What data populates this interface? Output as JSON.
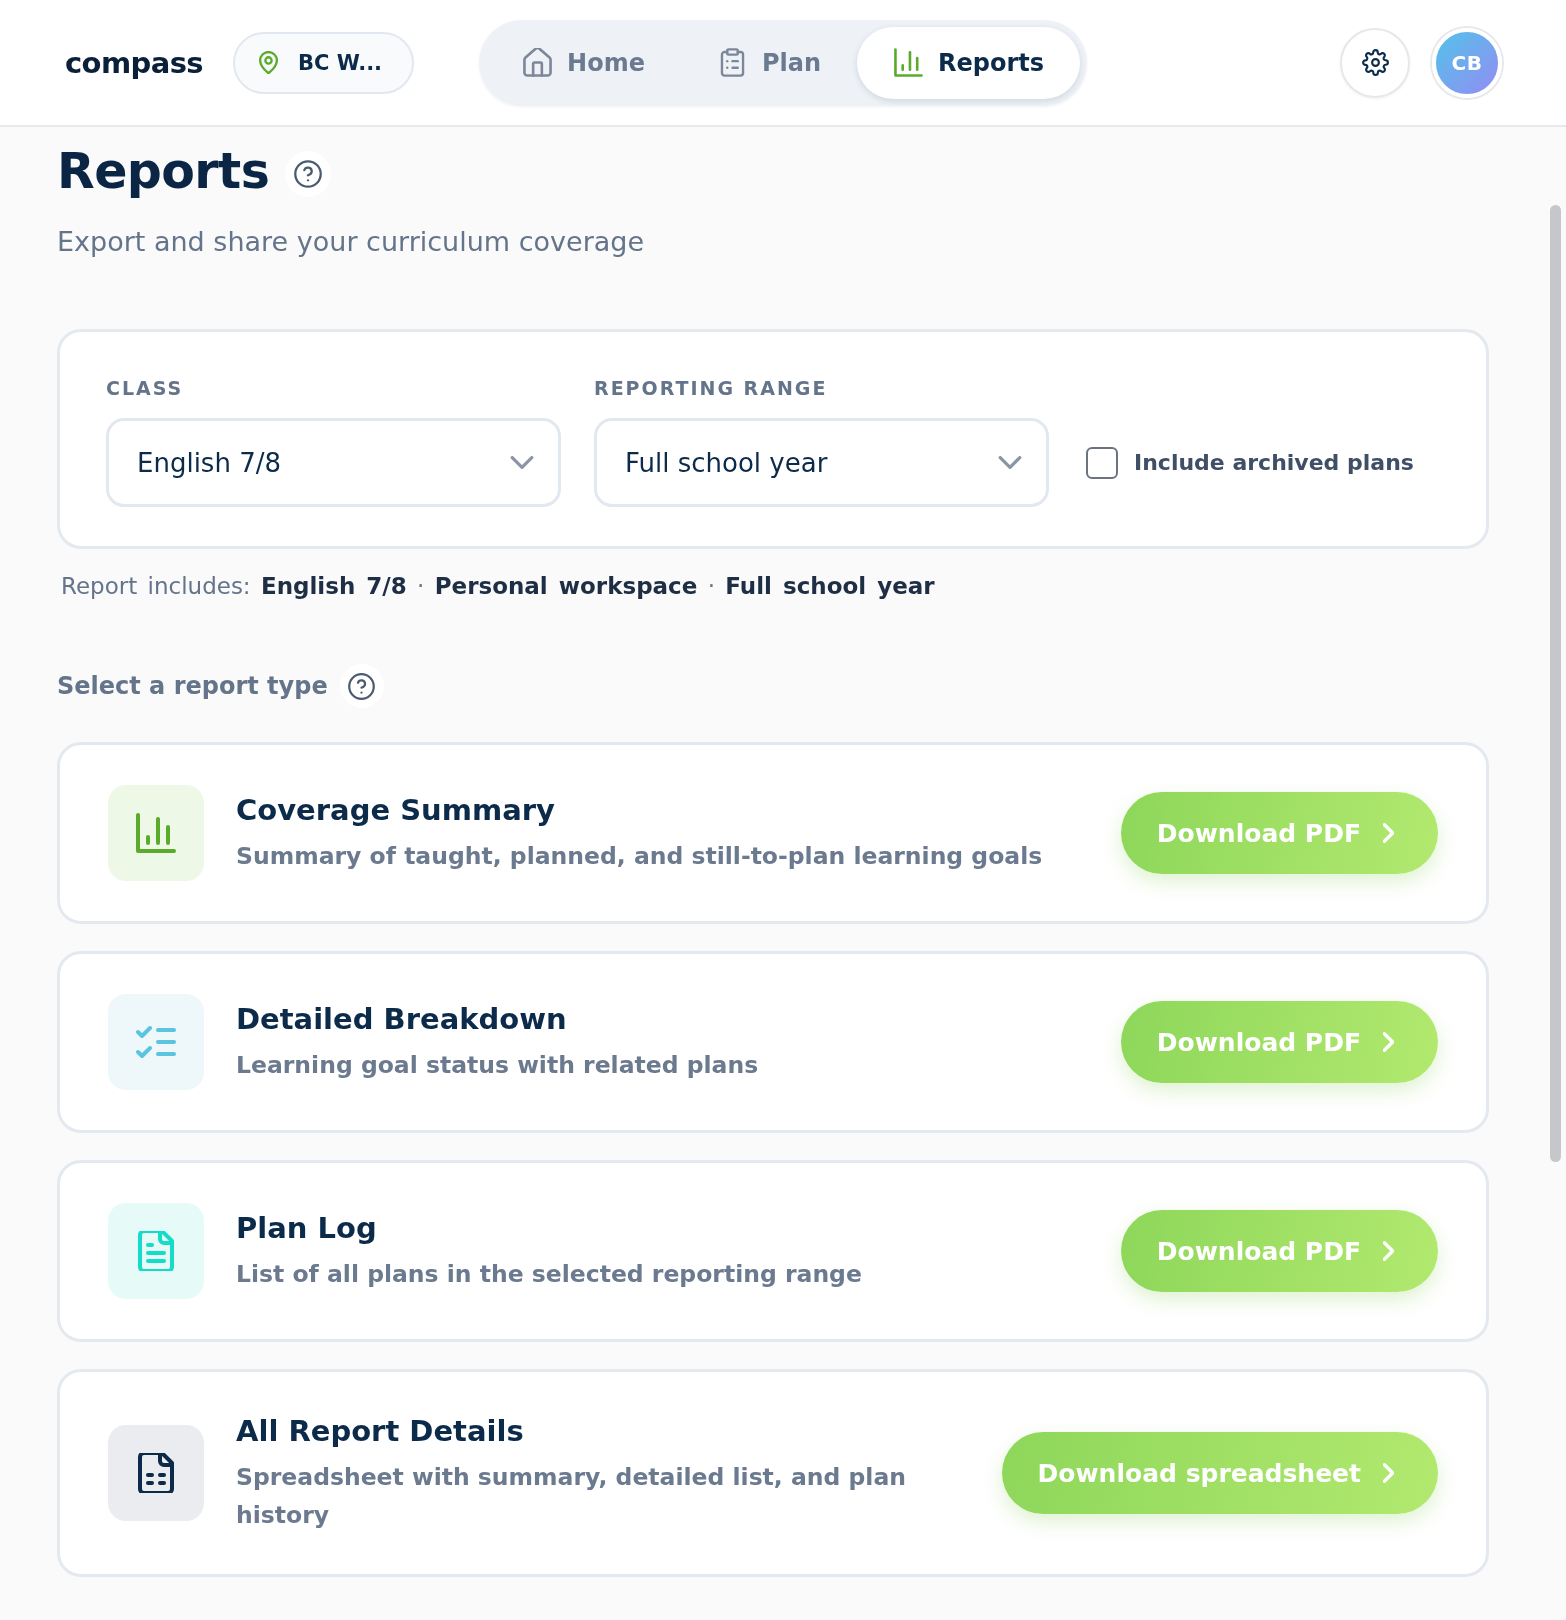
{
  "header": {
    "logo": "compass",
    "location": "BC W...",
    "tabs": [
      {
        "label": "Home",
        "selected": false
      },
      {
        "label": "Plan",
        "selected": false
      },
      {
        "label": "Reports",
        "selected": true
      }
    ],
    "avatar": "CB"
  },
  "page": {
    "title": "Reports",
    "subtitle": "Export and share your curriculum coverage"
  },
  "filters": {
    "class": {
      "label": "CLASS",
      "value": "English 7/8"
    },
    "range": {
      "label": "REPORTING RANGE",
      "value": "Full school year"
    },
    "include_archived": {
      "label": "Include archived plans",
      "checked": false
    }
  },
  "summary": "Report includes: **English 7/8** · **Personal workspace** · **Full school year**",
  "report_types": {
    "heading": "Select a report type",
    "items": [
      {
        "title": "Coverage Summary",
        "description": "Summary of taught, planned, and still-to-plan learning goals",
        "button": "Download PDF"
      },
      {
        "title": "Detailed Breakdown",
        "description": "Learning goal status with related plans",
        "button": "Download PDF"
      },
      {
        "title": "Plan Log",
        "description": "List of all plans in the selected reporting range",
        "button": "Download PDF"
      },
      {
        "title": "All Report Details",
        "description": "Spreadsheet with summary, detailed list, and plan history",
        "button": "Download spreadsheet"
      }
    ]
  }
}
